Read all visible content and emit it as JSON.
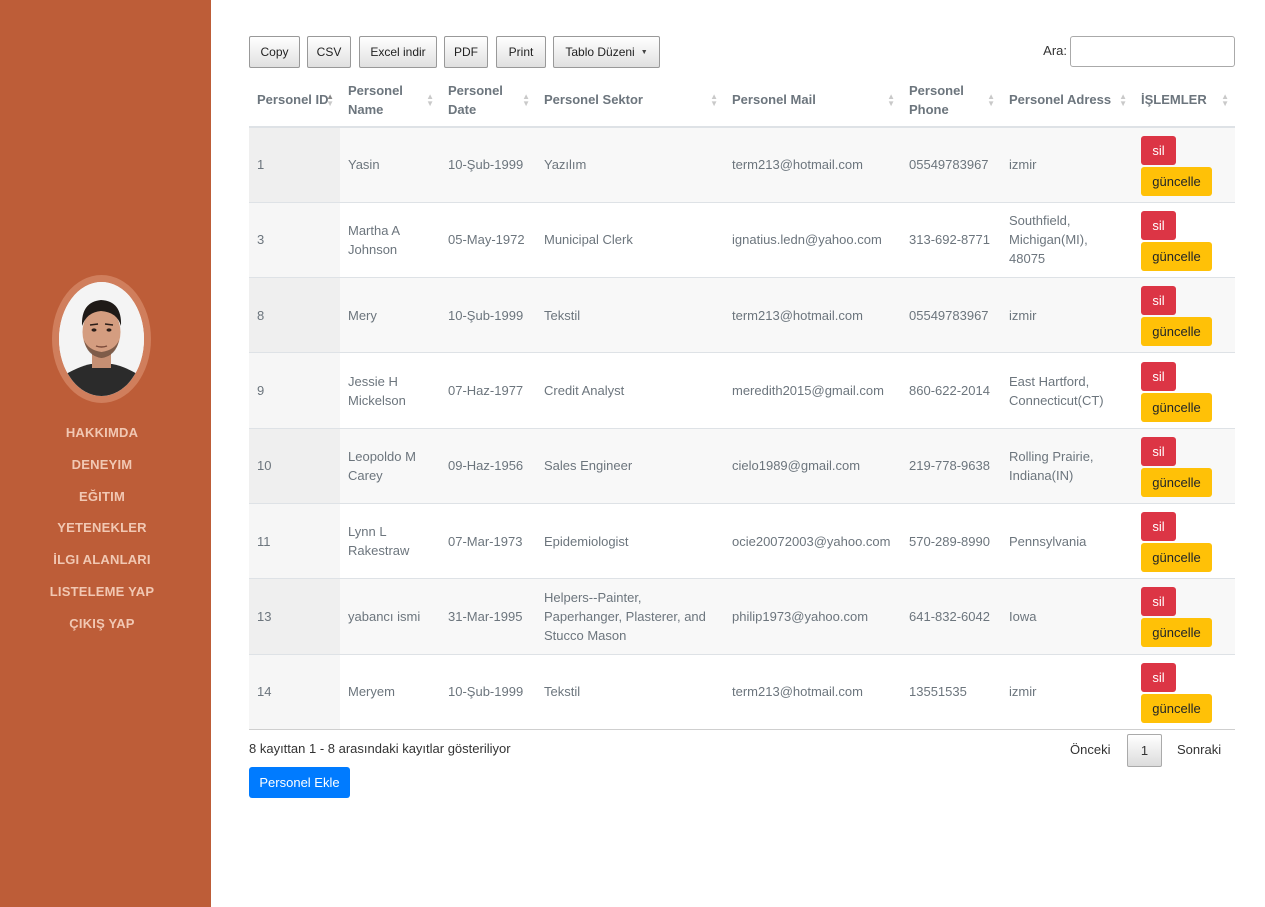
{
  "sidebar": {
    "nav": [
      "HAKKIMDA",
      "DENEYIM",
      "EĞITIM",
      "YETENEKLER",
      "İLGI ALANLARI",
      "LISTELEME YAP",
      "ÇIKIŞ YAP"
    ],
    "colors": {
      "background": "#bd5d38",
      "nav_text": "#f1c8b3"
    }
  },
  "toolbar": {
    "copy": "Copy",
    "csv": "CSV",
    "excel": "Excel indir",
    "pdf": "PDF",
    "print": "Print",
    "layout": "Tablo Düzeni",
    "search_label": "Ara:",
    "search_value": ""
  },
  "table": {
    "columns": [
      "Personel ID",
      "Personel Name",
      "Personel Date",
      "Personel Sektor",
      "Personel Mail",
      "Personel Phone",
      "Personel Adress",
      "İŞLEMLER"
    ],
    "rows": [
      [
        "1",
        "Yasin",
        "10-Şub-1999",
        "Yazılım",
        "term213@hotmail.com",
        "05549783967",
        "izmir"
      ],
      [
        "3",
        "Martha A Johnson",
        "05-May-1972",
        "Municipal Clerk",
        "ignatius.ledn@yahoo.com",
        "313-692-8771",
        "Southfield, Michigan(MI), 48075"
      ],
      [
        "8",
        "Mery",
        "10-Şub-1999",
        "Tekstil",
        "term213@hotmail.com",
        "05549783967",
        "izmir"
      ],
      [
        "9",
        "Jessie H Mickelson",
        "07-Haz-1977",
        "Credit Analyst",
        "meredith2015@gmail.com",
        "860-622-2014",
        "East Hartford, Connecticut(CT)"
      ],
      [
        "10",
        "Leopoldo M Carey",
        "09-Haz-1956",
        "Sales Engineer",
        "cielo1989@gmail.com",
        "219-778-9638",
        "Rolling Prairie, Indiana(IN)"
      ],
      [
        "11",
        "Lynn L Rakestraw",
        "07-Mar-1973",
        "Epidemiologist",
        "ocie20072003@yahoo.com",
        "570-289-8990",
        "Pennsylvania"
      ],
      [
        "13",
        "yabancı ismi",
        "31-Mar-1995",
        "Helpers--Painter, Paperhanger, Plasterer, and Stucco Mason",
        "philip1973@yahoo.com",
        "641-832-6042",
        "Iowa"
      ],
      [
        "14",
        "Meryem",
        "10-Şub-1999",
        "Tekstil",
        "term213@hotmail.com",
        "13551535",
        "izmir"
      ]
    ],
    "delete_label": "sil",
    "update_label": "güncelle",
    "colors": {
      "delete": "#dc3545",
      "update": "#ffc107"
    }
  },
  "footer": {
    "info": "8 kayıttan 1 - 8 arasındaki kayıtlar gösteriliyor",
    "prev": "Önceki",
    "page": "1",
    "next": "Sonraki",
    "add_button": "Personel Ekle",
    "add_color": "#007bff"
  }
}
